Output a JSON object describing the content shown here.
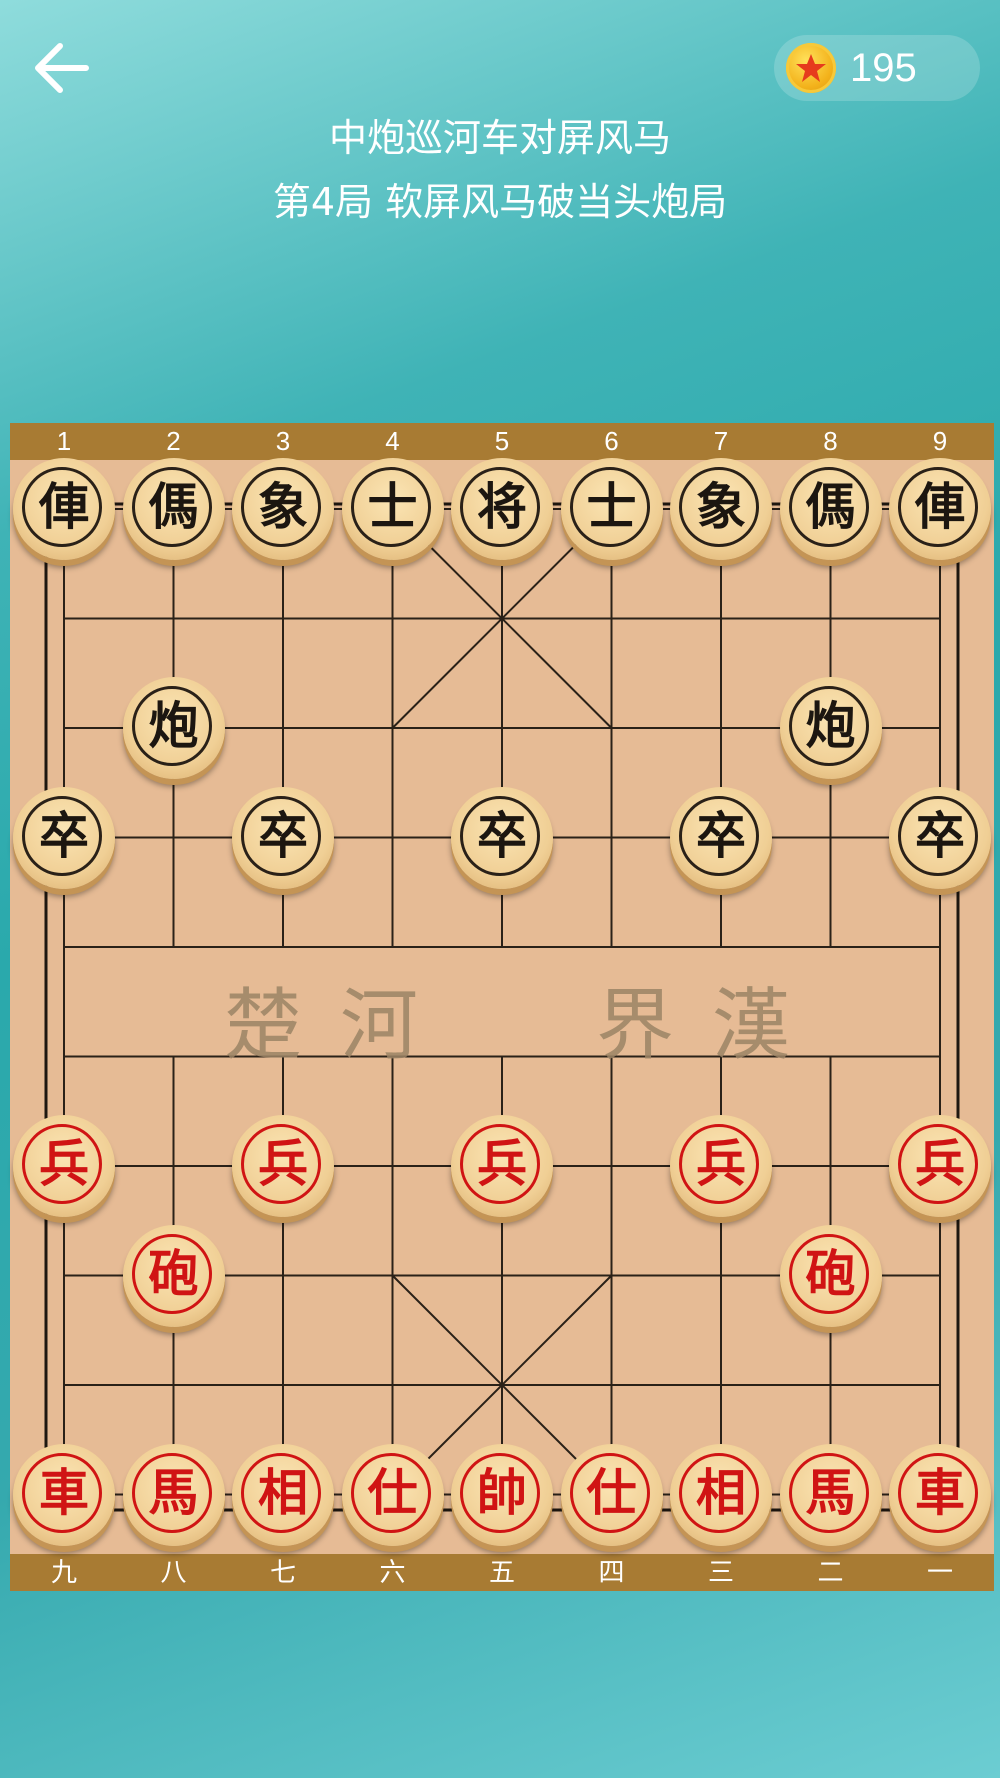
{
  "header": {
    "coins": "195",
    "title": "中炮巡河车对屏风马",
    "subtitle": "第4局 软屏风马破当头炮局"
  },
  "board": {
    "top_labels": [
      "1",
      "2",
      "3",
      "4",
      "5",
      "6",
      "7",
      "8",
      "9"
    ],
    "bottom_labels": [
      "九",
      "八",
      "七",
      "六",
      "五",
      "四",
      "三",
      "二",
      "一"
    ],
    "river_left": [
      "楚",
      "河"
    ],
    "river_right": [
      "界",
      "漢"
    ],
    "pieces": [
      {
        "id": "black-chariot-1",
        "char": "俥",
        "side": "black",
        "col": 0,
        "row": 0
      },
      {
        "id": "black-horse-1",
        "char": "傌",
        "side": "black",
        "col": 1,
        "row": 0
      },
      {
        "id": "black-elephant-1",
        "char": "象",
        "side": "black",
        "col": 2,
        "row": 0
      },
      {
        "id": "black-advisor-1",
        "char": "士",
        "side": "black",
        "col": 3,
        "row": 0
      },
      {
        "id": "black-general",
        "char": "将",
        "side": "black",
        "col": 4,
        "row": 0
      },
      {
        "id": "black-advisor-2",
        "char": "士",
        "side": "black",
        "col": 5,
        "row": 0
      },
      {
        "id": "black-elephant-2",
        "char": "象",
        "side": "black",
        "col": 6,
        "row": 0
      },
      {
        "id": "black-horse-2",
        "char": "傌",
        "side": "black",
        "col": 7,
        "row": 0
      },
      {
        "id": "black-chariot-2",
        "char": "俥",
        "side": "black",
        "col": 8,
        "row": 0
      },
      {
        "id": "black-cannon-1",
        "char": "炮",
        "side": "black",
        "col": 1,
        "row": 2
      },
      {
        "id": "black-cannon-2",
        "char": "炮",
        "side": "black",
        "col": 7,
        "row": 2
      },
      {
        "id": "black-soldier-1",
        "char": "卒",
        "side": "black",
        "col": 0,
        "row": 3
      },
      {
        "id": "black-soldier-2",
        "char": "卒",
        "side": "black",
        "col": 2,
        "row": 3
      },
      {
        "id": "black-soldier-3",
        "char": "卒",
        "side": "black",
        "col": 4,
        "row": 3
      },
      {
        "id": "black-soldier-4",
        "char": "卒",
        "side": "black",
        "col": 6,
        "row": 3
      },
      {
        "id": "black-soldier-5",
        "char": "卒",
        "side": "black",
        "col": 8,
        "row": 3
      },
      {
        "id": "red-soldier-1",
        "char": "兵",
        "side": "red",
        "col": 0,
        "row": 6
      },
      {
        "id": "red-soldier-2",
        "char": "兵",
        "side": "red",
        "col": 2,
        "row": 6
      },
      {
        "id": "red-soldier-3",
        "char": "兵",
        "side": "red",
        "col": 4,
        "row": 6
      },
      {
        "id": "red-soldier-4",
        "char": "兵",
        "side": "red",
        "col": 6,
        "row": 6
      },
      {
        "id": "red-soldier-5",
        "char": "兵",
        "side": "red",
        "col": 8,
        "row": 6
      },
      {
        "id": "red-cannon-1",
        "char": "砲",
        "side": "red",
        "col": 1,
        "row": 7
      },
      {
        "id": "red-cannon-2",
        "char": "砲",
        "side": "red",
        "col": 7,
        "row": 7
      },
      {
        "id": "red-chariot-1",
        "char": "車",
        "side": "red",
        "col": 0,
        "row": 9
      },
      {
        "id": "red-horse-1",
        "char": "馬",
        "side": "red",
        "col": 1,
        "row": 9
      },
      {
        "id": "red-elephant-1",
        "char": "相",
        "side": "red",
        "col": 2,
        "row": 9
      },
      {
        "id": "red-advisor-1",
        "char": "仕",
        "side": "red",
        "col": 3,
        "row": 9
      },
      {
        "id": "red-general",
        "char": "帥",
        "side": "red",
        "col": 4,
        "row": 9
      },
      {
        "id": "red-advisor-2",
        "char": "仕",
        "side": "red",
        "col": 5,
        "row": 9
      },
      {
        "id": "red-elephant-2",
        "char": "相",
        "side": "red",
        "col": 6,
        "row": 9
      },
      {
        "id": "red-horse-2",
        "char": "馬",
        "side": "red",
        "col": 7,
        "row": 9
      },
      {
        "id": "red-chariot-2",
        "char": "車",
        "side": "red",
        "col": 8,
        "row": 9
      }
    ]
  },
  "colors": {
    "board": "#e6bb95",
    "label_strip": "#a87b33",
    "red_piece": "#d01414",
    "black_piece": "#1c1610"
  },
  "icons": {
    "back": "arrow-left-icon",
    "coin": "star-coin-icon"
  }
}
